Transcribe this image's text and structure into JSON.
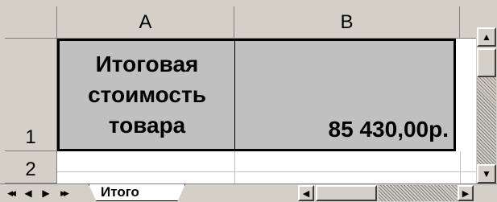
{
  "columns": [
    "A",
    "B"
  ],
  "rows": [
    "1",
    "2"
  ],
  "cells": {
    "A1": [
      "Итоговая",
      "стоимость",
      "товара"
    ],
    "B1": "85 430,00р."
  },
  "sheet_tab": "Итого",
  "colors": {
    "cell_fill": "#c0c0c0",
    "chrome": "#d4d0c8"
  },
  "icons": {
    "nav_first": "◀◀",
    "nav_prev": "◀",
    "nav_next": "▶",
    "nav_last": "▶▶",
    "scroll_up": "▲",
    "scroll_down": "▼",
    "scroll_left": "◀",
    "scroll_right": "▶"
  }
}
